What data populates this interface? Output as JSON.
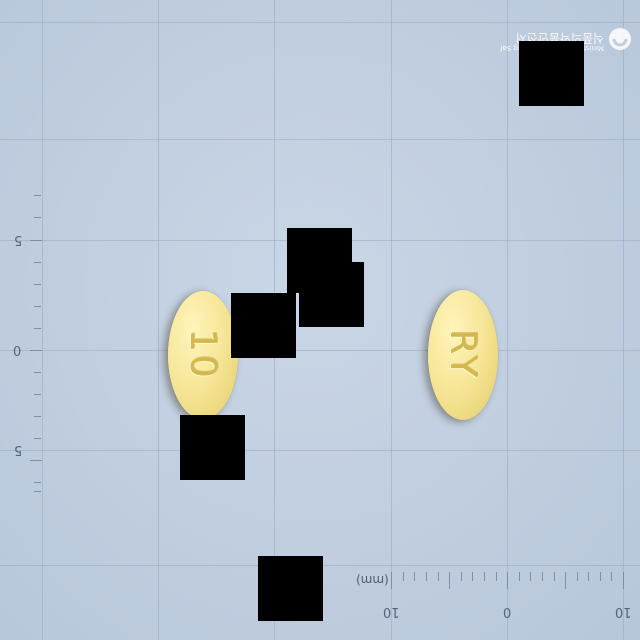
{
  "watermark": {
    "agency_korean": "식품의약품안전처",
    "agency_english": "Ministry of Food and Drug Safety"
  },
  "left_scale": {
    "labels": [
      "5",
      "0",
      "5"
    ]
  },
  "bottom_scale": {
    "labels": [
      "10",
      "0",
      "10"
    ],
    "unit": "(mm)"
  },
  "pills": [
    {
      "side": "front",
      "imprint": "10",
      "color": "#f4e391"
    },
    {
      "side": "back",
      "imprint": "RY",
      "color": "#f4e391"
    }
  ],
  "redaction_color": "#000000"
}
